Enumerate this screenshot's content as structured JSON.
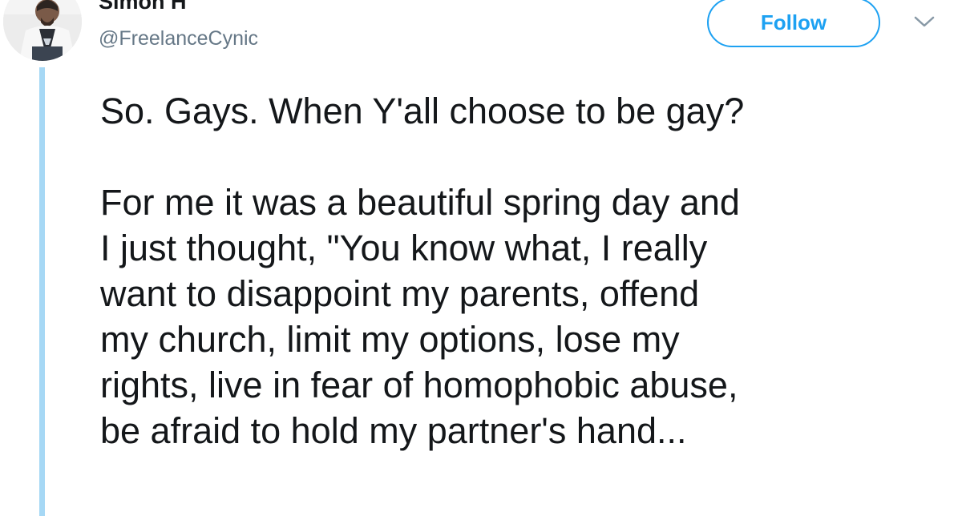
{
  "author": {
    "display_name": "Simon H",
    "handle": "@FreelanceCynic"
  },
  "actions": {
    "follow_label": "Follow",
    "menu_icon": "chevron-down-icon"
  },
  "tweet": {
    "first_paragraph": "So. Gays. When Y'all choose to be gay?",
    "second_paragraph_lines": [
      "For me it was a beautiful spring day and",
      "I just thought, \"You know what, I really",
      "want to disappoint my parents, offend",
      "my church, limit my options, lose my",
      "rights, live in fear of homophobic abuse,",
      "be afraid to hold my partner's hand..."
    ]
  },
  "colors": {
    "accent": "#1da1f2",
    "thread_line": "#a6d8f5",
    "text": "#14171a",
    "secondary_text": "#657786"
  }
}
